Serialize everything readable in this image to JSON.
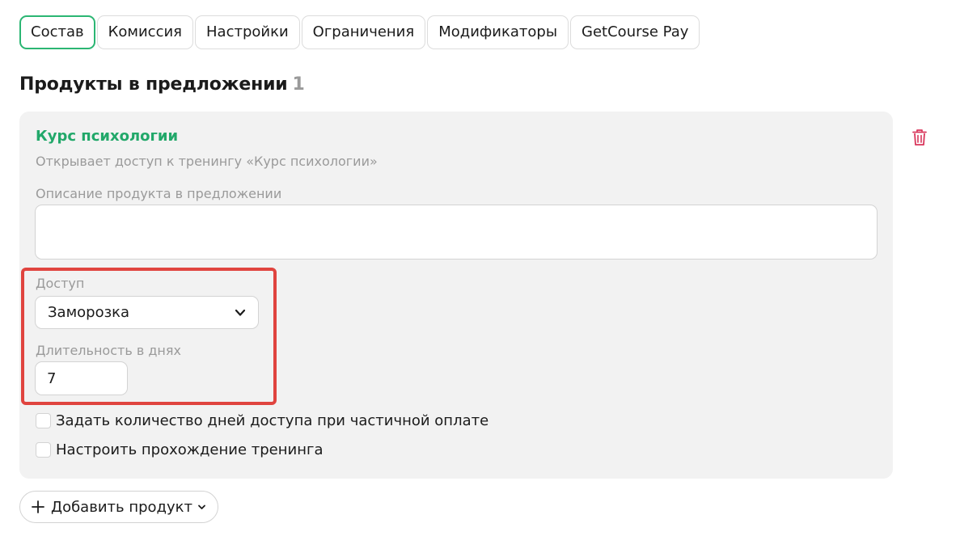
{
  "tabs": [
    {
      "label": "Состав",
      "active": true
    },
    {
      "label": "Комиссия",
      "active": false
    },
    {
      "label": "Настройки",
      "active": false
    },
    {
      "label": "Ограничения",
      "active": false
    },
    {
      "label": "Модификаторы",
      "active": false
    },
    {
      "label": "GetCourse Pay",
      "active": false
    }
  ],
  "section": {
    "title": "Продукты в предложении",
    "count": "1"
  },
  "product": {
    "name": "Курс психологии",
    "subtitle": "Открывает доступ к тренингу «Курс психологии»",
    "description_label": "Описание продукта в предложении",
    "description_value": "",
    "access_label": "Доступ",
    "access_value": "Заморозка",
    "duration_label": "Длительность в днях",
    "duration_value": "7",
    "checkbox_partial_payment": "Задать количество дней доступа при частичной оплате",
    "checkbox_training_progress": "Настроить прохождение тренинга"
  },
  "actions": {
    "add_product": "Добавить продукт"
  },
  "icons": {
    "delete": "trash-icon",
    "dropdown": "chevron-down-icon",
    "add": "plus-icon"
  },
  "colors": {
    "accent": "#2bb673",
    "product_name": "#22a86a",
    "highlight": "#e0443f",
    "delete": "#d9365b"
  }
}
